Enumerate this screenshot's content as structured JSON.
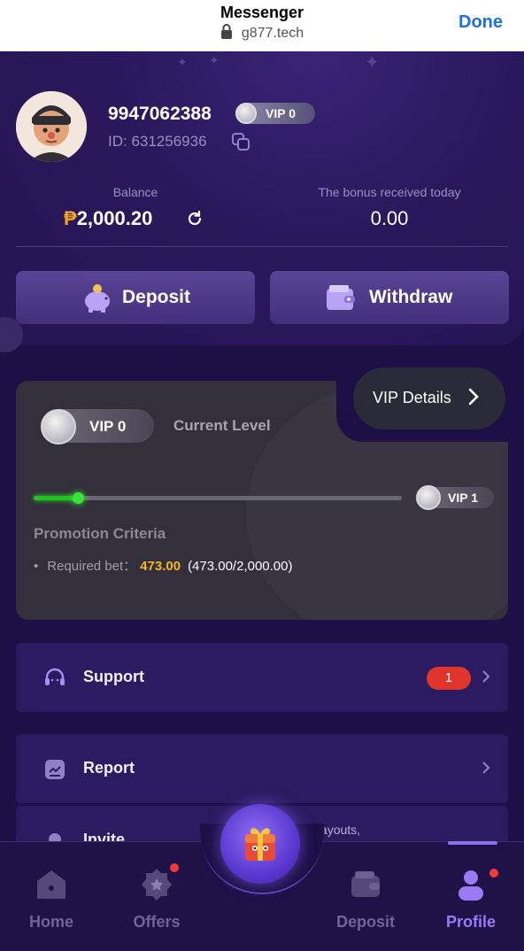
{
  "browser": {
    "title": "Messenger",
    "url": "g877.tech",
    "done_label": "Done"
  },
  "profile": {
    "username": "9947062388",
    "vip_badge": "VIP 0",
    "id_label": "ID: 631256936"
  },
  "balance": {
    "label": "Balance",
    "currency": "₱",
    "amount": "2,000.20",
    "bonus_label": "The bonus received today",
    "bonus_amount": "0.00"
  },
  "actions": {
    "deposit_label": "Deposit",
    "withdraw_label": "Withdraw"
  },
  "vip_card": {
    "details_label": "VIP Details",
    "current_badge": "VIP 0",
    "current_level_label": "Current Level",
    "next_badge": "VIP 1",
    "progress": 0.12,
    "promotion_title": "Promotion Criteria",
    "required_label": "Required bet：",
    "required_value": "473.00",
    "required_ratio": "(473.00/2,000.00)"
  },
  "menu": {
    "support_label": "Support",
    "support_count": "1",
    "report_label": "Report",
    "invite_label": "Invite",
    "promo_strip": "Rewards, Faster Payouts,"
  },
  "bottom_nav": {
    "home": "Home",
    "offers": "Offers",
    "deposit": "Deposit",
    "profile": "Profile"
  },
  "colors": {
    "background": "#1c1046",
    "accent": "#8d6ff0",
    "badge": "#e0352b",
    "progress": "#22c11e"
  }
}
